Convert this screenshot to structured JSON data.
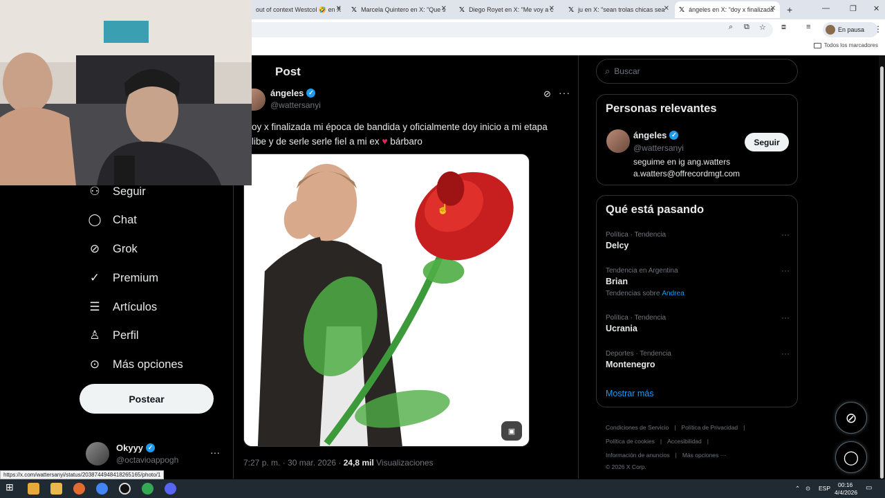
{
  "browser": {
    "tabs": [
      {
        "title": "out of context Westcol 🤣 en X"
      },
      {
        "title": "Marcela Quintero en X: \"Que s"
      },
      {
        "title": "Diego Royet en X: \"Me voy a c"
      },
      {
        "title": "ju en X: \"sean trolas chicas sea"
      },
      {
        "title": "ángeles en X: \"doy x finalizada"
      }
    ],
    "new_tab": "+",
    "paused_label": "En pausa",
    "bookmarks_all": "Todos los marcadores",
    "status_url": "https://x.com/wattersanyi/status/2038744948418265165/photo/1"
  },
  "post": {
    "header": "Post",
    "author_name": "ángeles",
    "author_handle": "@wattersanyi",
    "text_line1": "oy x finalizada mi época de bandida y oficialmente doy inicio a mi etapa",
    "text_line2_a": "libe y de serle serle fiel a mi ex ",
    "heart": "♥",
    "text_line2_b": " bárbaro",
    "time": "7:27 p. m. · 30 mar. 2026 · ",
    "views_count": "24,8 mil",
    "views_label": " Visualizaciones"
  },
  "nav": {
    "items": [
      {
        "label": "Seguir",
        "icon": "follow-icon"
      },
      {
        "label": "Chat",
        "icon": "chat-icon"
      },
      {
        "label": "Grok",
        "icon": "grok-icon"
      },
      {
        "label": "Premium",
        "icon": "premium-icon"
      },
      {
        "label": "Artículos",
        "icon": "articles-icon"
      },
      {
        "label": "Perfil",
        "icon": "profile-icon"
      },
      {
        "label": "Más opciones",
        "icon": "more-icon"
      }
    ],
    "post_button": "Postear",
    "account_name": "Okyyy",
    "account_handle": "@octavioappogh"
  },
  "sidebar": {
    "search_placeholder": "Buscar",
    "relevant_title": "Personas relevantes",
    "relevant_name": "ángeles",
    "relevant_handle": "@wattersanyi",
    "relevant_bio_1": "seguime en ig ang.watters",
    "relevant_bio_2": "a.watters@offrecordmgt.com",
    "follow_button": "Seguir",
    "trends_title": "Qué está pasando",
    "trends": [
      {
        "category": "Política · Tendencia",
        "name": "Delcy"
      },
      {
        "category": "Tendencia en Argentina",
        "name": "Brian",
        "sub": "Tendencias sobre",
        "sub_link": "Andrea"
      },
      {
        "category": "Política · Tendencia",
        "name": "Ucrania"
      },
      {
        "category": "Deportes · Tendencia",
        "name": "Montenegro"
      }
    ],
    "show_more": "Mostrar más",
    "footer": {
      "terms": "Condiciones de Servicio",
      "privacy": "Política de Privacidad",
      "cookies": "Política de cookies",
      "accessibility": "Accesibilidad",
      "ads": "Información de anuncios",
      "more": "Más opciones ···",
      "copyright": "© 2026 X Corp."
    }
  },
  "taskbar": {
    "lang": "ESP",
    "time": "00:16",
    "date": "4/4/2026"
  },
  "colors": {
    "accent": "#1d9bf0",
    "background": "#000000",
    "border": "#2f3336",
    "muted": "#71767b"
  }
}
